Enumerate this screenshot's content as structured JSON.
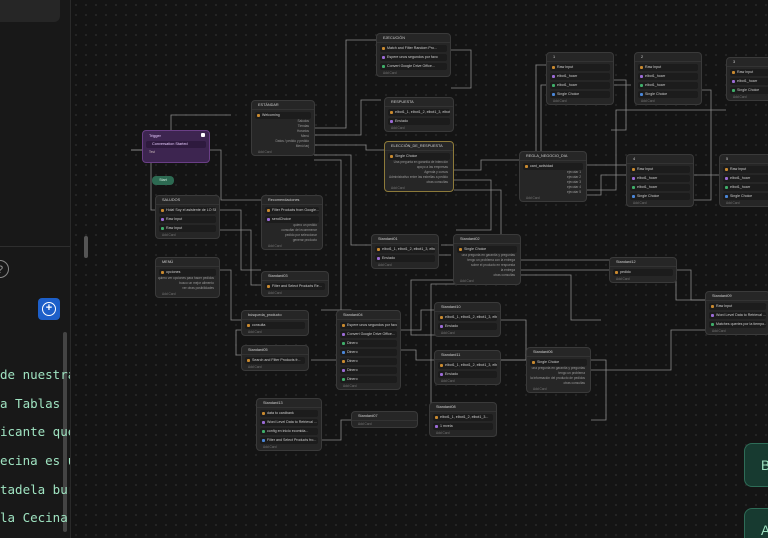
{
  "editor": {
    "code_lines": [
      "de nuestra",
      "a Tablas (",
      "icante que",
      "ecina es u",
      "tadela bur",
      "la Cecina"
    ],
    "help_icon": "question-circle-icon",
    "add_icon": "plus-circle-icon"
  },
  "trigger": {
    "title": "Trigger",
    "block": "Conversation Started",
    "footer": "Test"
  },
  "start_label": "Start",
  "nodes": {
    "ejecucion": {
      "title": "EJECUCIÓN",
      "blocks": [
        "Match and Filter Random Pro...",
        "Espere unos segundos por favo",
        "Convert Google Drive Office..."
      ],
      "add": "Add Card"
    },
    "estandar": {
      "title": "ESTÁNDAR",
      "blocks": [
        "Welcoming"
      ],
      "rows": [
        "Saludos",
        "Tiendas",
        "Horarios",
        "Menú",
        "Datos / pedido y pedido",
        "Menú tarj"
      ],
      "add": "Add Card"
    },
    "respuesta": {
      "title": "RESPUESTA",
      "blocks": [
        "elbot1_1, elbot1_2, elbot1_3, elbot1_4...",
        "Enviado"
      ],
      "add": "Add Card"
    },
    "eleccion": {
      "title": "ELECCIÓN_DE_RESPUESTA",
      "blocks": [
        "Single Choice"
      ],
      "rows": [
        "Una pregunta en garantía de intención",
        "apoyo a las empresas",
        "Agenda y cursos",
        "Administrativo entre las estrellas a pedido",
        "otras consultas"
      ],
      "add": "Add Card"
    },
    "n1": {
      "title": "1",
      "blocks": [
        "Raw Input",
        "elbot1_hoarr",
        "elbot1_hoarr",
        "Single Choice"
      ],
      "add": "Add Card"
    },
    "n2": {
      "title": "2",
      "blocks": [
        "Raw Input",
        "elbot1_hoarr",
        "elbot1_hoarr",
        "Single Choice"
      ],
      "add": "Add Card"
    },
    "n3": {
      "title": "3",
      "blocks": [
        "Raw Input",
        "elbot1_hoarr",
        "Single Choice"
      ],
      "add": "Add Card"
    },
    "n4": {
      "title": "4",
      "blocks": [
        "Raw Input",
        "elbot1_hoarr",
        "elbot1_hoarr",
        "Single Choice"
      ],
      "add": "Add Card"
    },
    "n5": {
      "title": "5",
      "blocks": [
        "Raw Input",
        "elbot1_hoarr",
        "elbot1_hoarr",
        "Single Choice"
      ],
      "add": "Add Card"
    },
    "regla": {
      "title": "REGLA_NEGOCIO_DIA",
      "blocks": [
        "cant_actividad"
      ],
      "rows": [
        "ejecutar 1",
        "ejecutar 2",
        "ejecutar 3",
        "ejecutar 4",
        "ejecutar 5"
      ],
      "add": "Add Card"
    },
    "saludos": {
      "title": "SALUDOS",
      "blocks": [
        "Hola! Soy el asistente de LO SEL...",
        "Raw Input",
        "Raw Input"
      ],
      "add": "Add Card"
    },
    "recomendaciones": {
      "title": "Recomendaciones",
      "blocks": [
        "Filter Products from Google...",
        "sendChoice"
      ],
      "rows": [
        "quiero un pedido",
        "consultar del ecommerce",
        "pedido por seleccionar",
        "generar producto"
      ],
      "add": "Add Card"
    },
    "menu": {
      "title": "MENÚ",
      "blocks": [
        "opciones"
      ],
      "rows": [
        "quiero ver opciones para hacer pedidos",
        "busco un mejor alimento",
        "ver otras posibilidades"
      ],
      "add": "Add Card"
    },
    "s01": {
      "title": "Standard01",
      "blocks": [
        "elbot1_1, elbot1_2, elbot1_3, elbot1_4...",
        "Enviado"
      ],
      "add": "Add Card"
    },
    "s02": {
      "title": "Standard02",
      "blocks": [
        "Single Choice"
      ],
      "rows": [
        "una pregunta en garantía y preguntas",
        "tengo un problema con la entrega",
        "sobre el producto en respuesta",
        "la entrega",
        "otras consultas"
      ],
      "add": "Add Card"
    },
    "s03": {
      "title": "Standard03",
      "blocks": [
        "Filter and Select Products Re..."
      ],
      "add": "Add Card"
    },
    "s04": {
      "title": "Standard04",
      "blocks": [
        "Espere unos segundos por favor",
        "Convert Google Drive Office...",
        "Dinero",
        "Dinero",
        "Dinero",
        "Dinero",
        "Dinero"
      ],
      "add": "Add Card"
    },
    "s05": {
      "title": "Standard05",
      "blocks": [
        "Search and Filter Products fr..."
      ],
      "add": "Add Card"
    },
    "s06": {
      "title": "Standard06",
      "blocks": [
        "Single Choice"
      ],
      "rows": [
        "una pregunta en garantía y preguntas",
        "tengo un problema",
        "la información del producto de pedidos",
        "otras consultas"
      ],
      "add": "Add Card"
    },
    "s07": {
      "title": "Standard07",
      "blocks": [],
      "add": "Add Card"
    },
    "s08": {
      "title": "Standard08",
      "blocks": [
        "elbot1_1, elbot1_2, elbot1_3...",
        "1 mvela"
      ],
      "add": "Add Card"
    },
    "s09": {
      "title": "Standard09",
      "blocks": [
        "Raw Input",
        "Word Level Data to Retrieval ...",
        "Matches queries por la tiempo..."
      ],
      "add": "Add Card"
    },
    "s10": {
      "title": "Standard10",
      "blocks": [
        "elbot1_1, elbot1_2, elbot1_3, elbot1_4...",
        "Enviado"
      ],
      "add": "Add Card"
    },
    "s11": {
      "title": "Standard11",
      "blocks": [
        "elbot1_1, elbot1_2, elbot1_3, elbot1_4...",
        "Enviado"
      ],
      "add": "Add Card"
    },
    "s12": {
      "title": "Standard12",
      "blocks": [
        "pedido"
      ],
      "add": "Add Card"
    },
    "s13": {
      "title": "Standard13",
      "blocks": [
        "data to cardbank",
        "Word Level Data to Retrieval ...",
        "config en inicio ecomida...",
        "Filter and Select Products fro..."
      ],
      "add": "Add Card"
    },
    "busqueda": {
      "title": "búsqueda_producto",
      "blocks": [
        "consulta"
      ],
      "add": "Add Card"
    }
  },
  "toasts": {
    "published": "Bot published",
    "new_version": "A new version"
  }
}
